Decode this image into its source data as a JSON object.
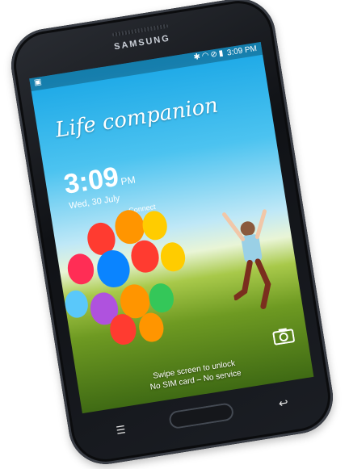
{
  "device": {
    "brand": "SAMSUNG"
  },
  "statusbar": {
    "time": "3:09 PM",
    "icons": [
      "bluetooth-icon",
      "wifi-icon",
      "no-signal-icon",
      "battery-icon"
    ]
  },
  "lockscreen": {
    "slogan": "Life companion",
    "clock": "3:09",
    "ampm": "PM",
    "date": "Wed, 30 July",
    "connect_text": "Connect",
    "swipe_text": "Swipe screen to unlock",
    "sim_status": "No SIM card – No service"
  },
  "colors": {
    "sky": "#1aa7e6",
    "grass": "#6e9a22",
    "body": "#101216"
  }
}
